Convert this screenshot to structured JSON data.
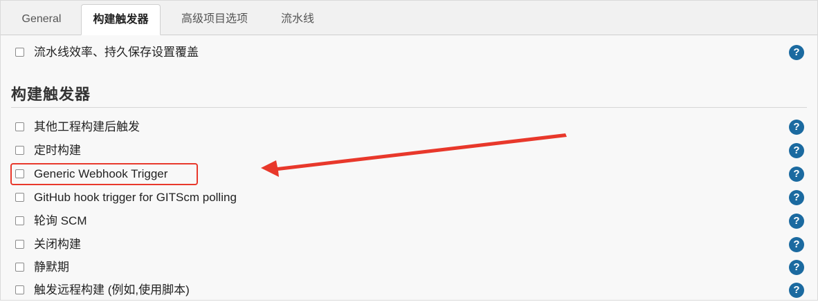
{
  "tabs": [
    {
      "label": "General"
    },
    {
      "label": "构建触发器",
      "active": true
    },
    {
      "label": "高级项目选项"
    },
    {
      "label": "流水线"
    }
  ],
  "pipeline_override": {
    "label": "流水线效率、持久保存设置覆盖",
    "checked": false
  },
  "section": {
    "title": "构建触发器"
  },
  "triggers": [
    {
      "label": "其他工程构建后触发",
      "checked": false
    },
    {
      "label": "定时构建",
      "checked": false
    },
    {
      "label": "Generic Webhook Trigger",
      "checked": false,
      "highlighted": true
    },
    {
      "label": "GitHub hook trigger for GITScm polling",
      "checked": false
    },
    {
      "label": "轮询 SCM",
      "checked": false
    },
    {
      "label": "关闭构建",
      "checked": false
    },
    {
      "label": "静默期",
      "checked": false
    },
    {
      "label": "触发远程构建 (例如,使用脚本)",
      "checked": false
    }
  ],
  "help_icon_glyph": "?",
  "colors": {
    "help": "#1b6aa0",
    "annotation": "#e8382b"
  }
}
